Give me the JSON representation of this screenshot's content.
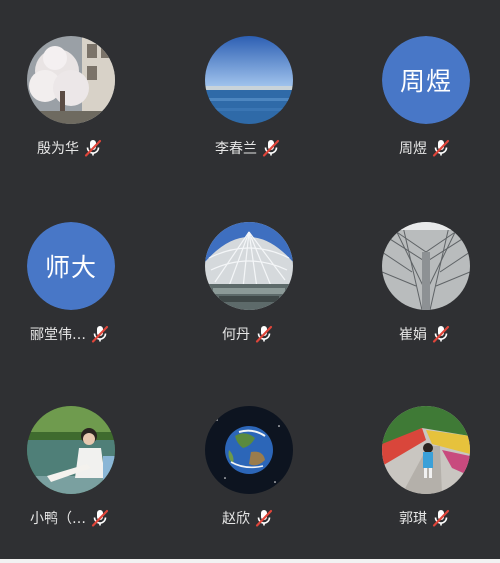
{
  "colors": {
    "background": "#2f3033",
    "initials_background": "#4877c7",
    "name_text": "#e6e6e6",
    "mic_muted_slash": "#e0453a"
  },
  "participants": [
    {
      "name": "殷为华",
      "avatar": "photo-tree-blossom",
      "mic": "muted"
    },
    {
      "name": "李春兰",
      "avatar": "photo-sea-horizon",
      "mic": "muted"
    },
    {
      "name": "周煜",
      "avatar": "initials",
      "initials": "周煜",
      "mic": "muted"
    },
    {
      "name": "郦堂伟…",
      "avatar": "initials",
      "initials": "师大",
      "mic": "muted"
    },
    {
      "name": "何丹",
      "avatar": "photo-glass-roof",
      "mic": "muted"
    },
    {
      "name": "崔娟",
      "avatar": "photo-steel-structure",
      "mic": "muted"
    },
    {
      "name": "小鸭（…",
      "avatar": "photo-person-lake",
      "mic": "muted"
    },
    {
      "name": "赵欣",
      "avatar": "photo-earth",
      "mic": "muted"
    },
    {
      "name": "郭琪",
      "avatar": "photo-child-flowers",
      "mic": "muted"
    }
  ]
}
